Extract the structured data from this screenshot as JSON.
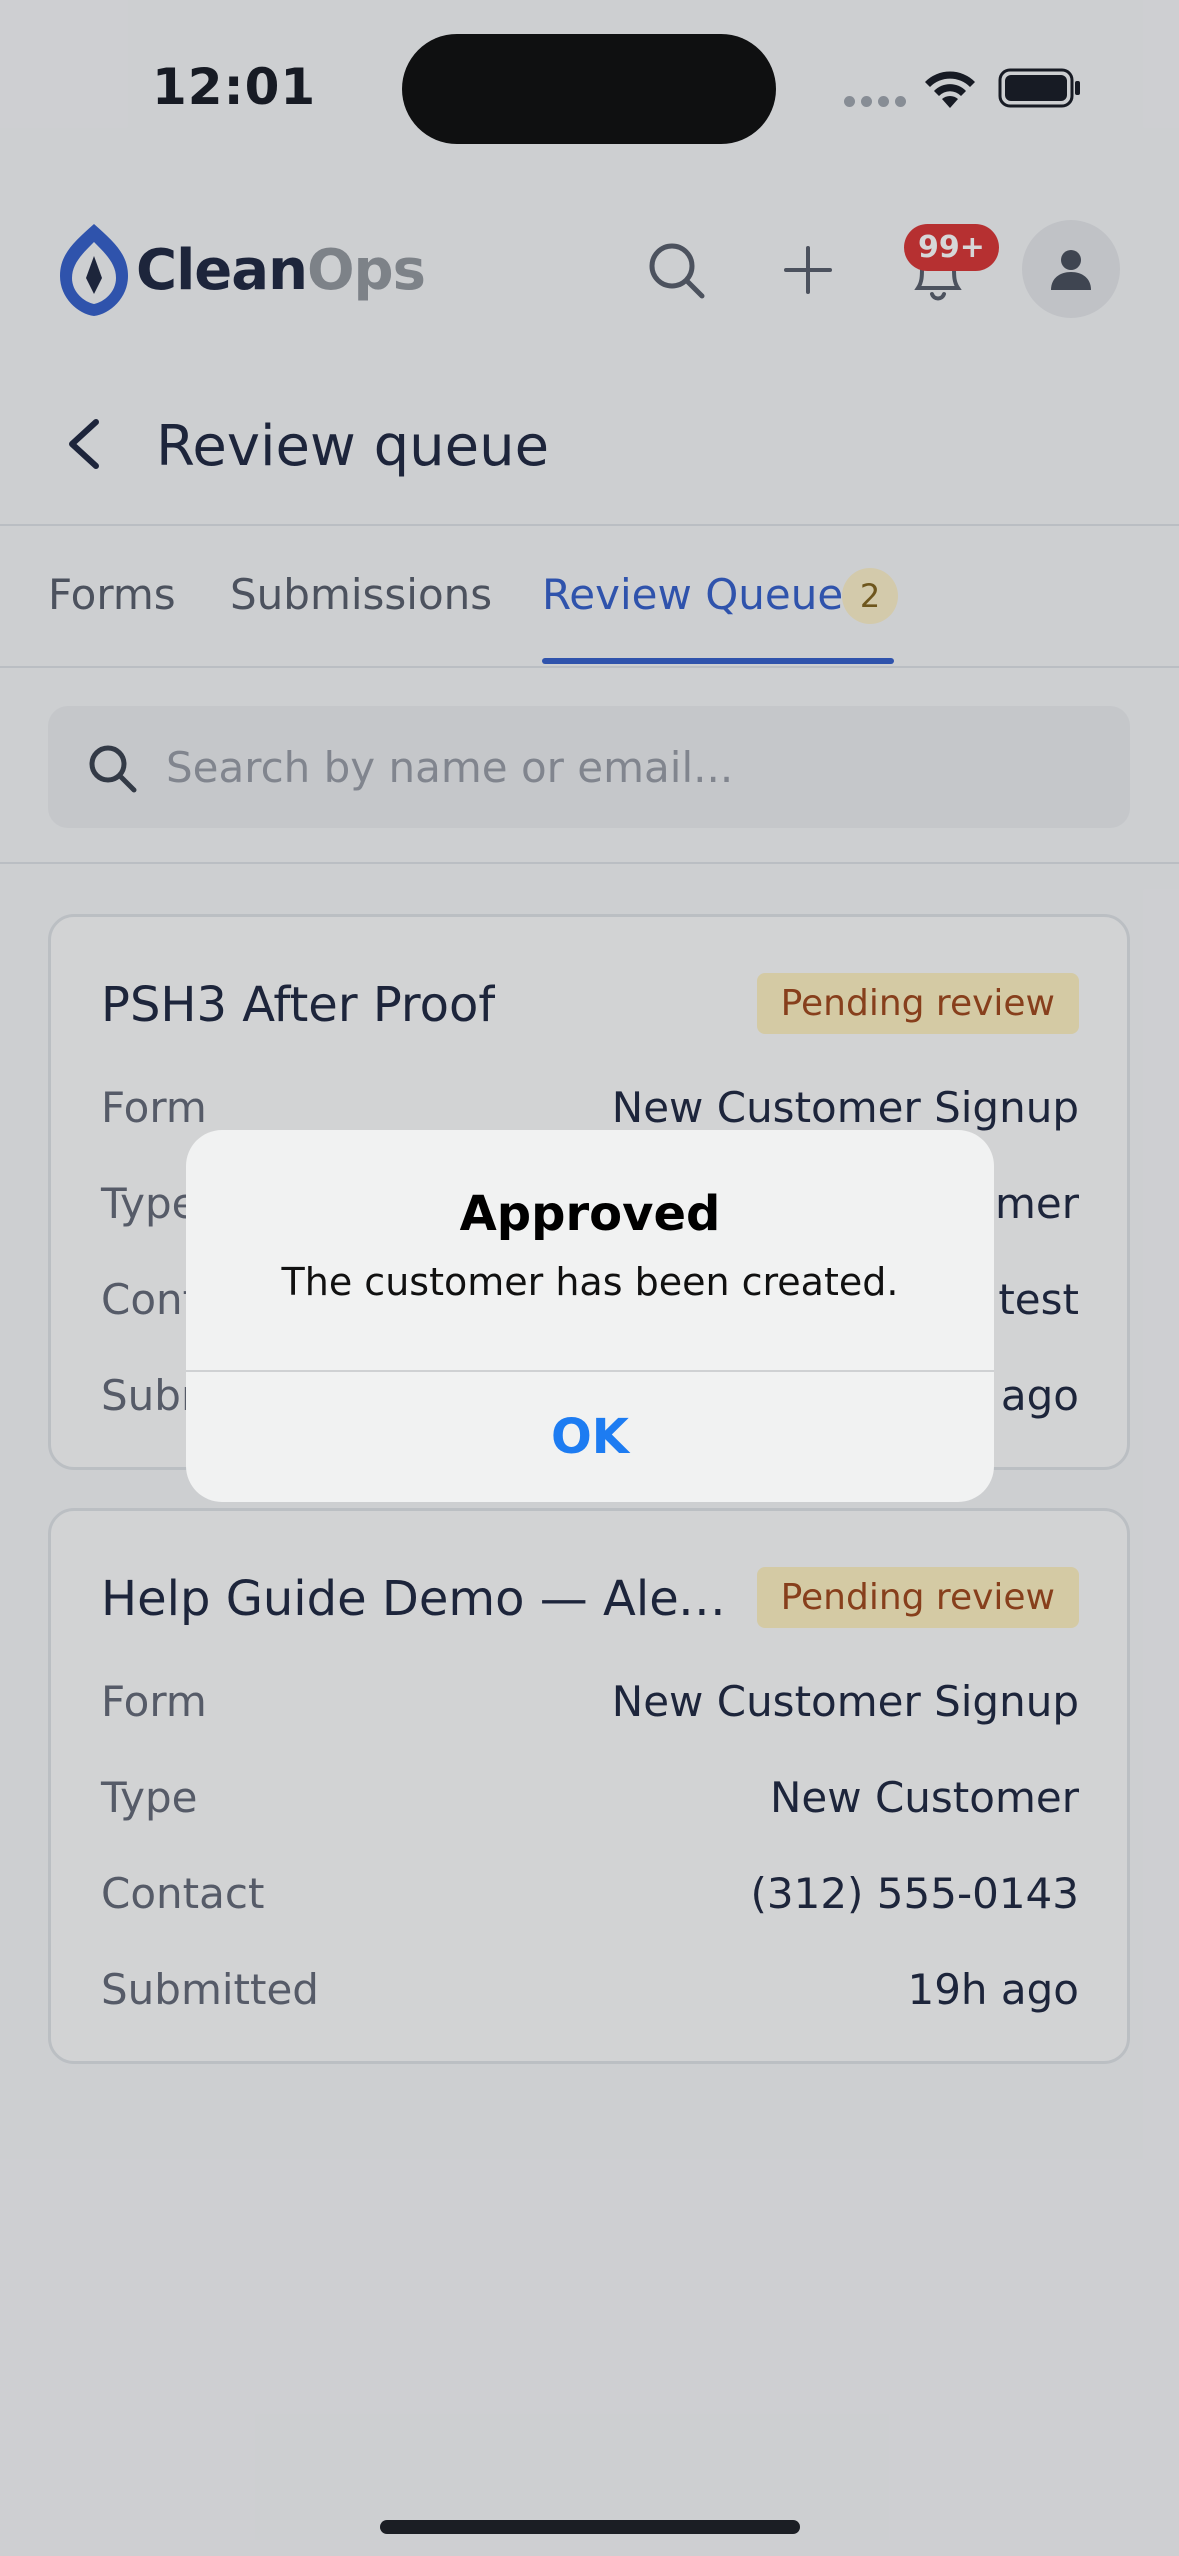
{
  "status_bar": {
    "time": "12:01"
  },
  "header": {
    "logo_primary": "Clean",
    "logo_secondary": "Ops",
    "notification_count": "99+",
    "brand_color": "#2957c7"
  },
  "page": {
    "title": "Review queue"
  },
  "tabs": [
    {
      "label": "Forms"
    },
    {
      "label": "Submissions"
    },
    {
      "label": "Review Queue",
      "active": true,
      "count": "2"
    }
  ],
  "search": {
    "placeholder": "Search by name or email..."
  },
  "cards": [
    {
      "title": "PSH3 After Proof",
      "status": "Pending review",
      "rows": [
        {
          "label": "Form",
          "value": "New Customer Signup"
        },
        {
          "label": "Type",
          "value": "New Customer"
        },
        {
          "label": "Contact",
          "value": "psh3@example.test"
        },
        {
          "label": "Submitted",
          "value": "1m ago"
        }
      ]
    },
    {
      "title": "Help Guide Demo — Alexan...",
      "status": "Pending review",
      "rows": [
        {
          "label": "Form",
          "value": "New Customer Signup"
        },
        {
          "label": "Type",
          "value": "New Customer"
        },
        {
          "label": "Contact",
          "value": "(312) 555-0143"
        },
        {
          "label": "Submitted",
          "value": "19h ago"
        }
      ]
    }
  ],
  "alert": {
    "title": "Approved",
    "message": "The customer has been created.",
    "ok_label": "OK"
  }
}
